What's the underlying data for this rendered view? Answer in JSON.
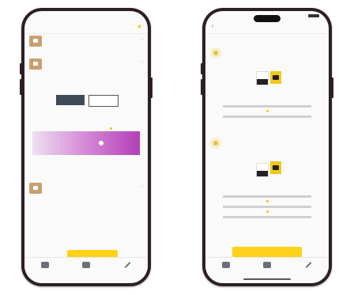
{
  "left_phone": {
    "nav_title": "",
    "rows": [
      {
        "title": "",
        "subtitle": ""
      },
      {
        "title": "",
        "subtitle": ""
      },
      {
        "title": "",
        "subtitle": ""
      }
    ],
    "segments": [
      "",
      ""
    ],
    "value": "",
    "cta_label": "",
    "tabs": [
      "",
      "",
      ""
    ]
  },
  "right_phone": {
    "status_time": "",
    "nav_title": "",
    "cards": [
      {
        "title": "",
        "subtitle": ""
      },
      {
        "title": "",
        "subtitle": ""
      }
    ],
    "cta_label": "",
    "tabs": [
      "",
      "",
      ""
    ]
  },
  "colors": {
    "accent_yellow": "#ffd21a",
    "gradient_start": "#eedff2",
    "gradient_end": "#b43fb7",
    "phone_frame": "#2e1f27"
  },
  "icons": [
    "back-chevron-icon",
    "star-icon",
    "home-icon",
    "box-icon",
    "pen-icon"
  ]
}
